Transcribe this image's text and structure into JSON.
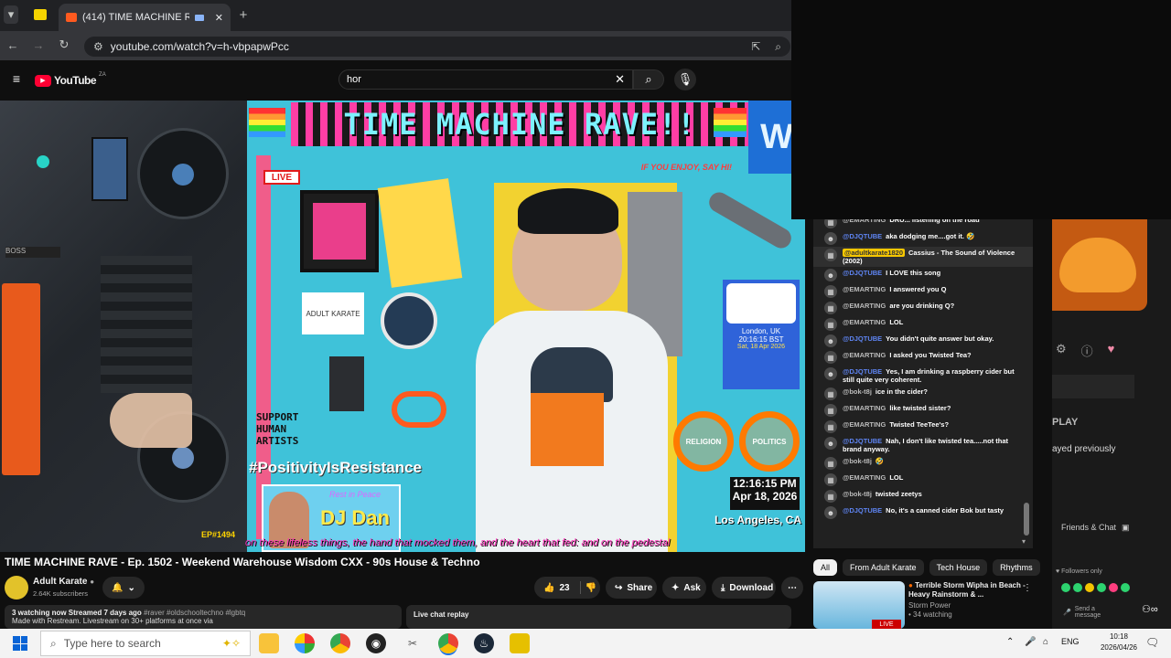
{
  "browser": {
    "tab_title": "(414) TIME MACHINE RAVE",
    "url": "youtube.com/watch?v=h-vbpapwPcc"
  },
  "youtube": {
    "logo": "YouTube",
    "logo_region": "ZA",
    "search_value": "hor"
  },
  "video": {
    "banner": "TIME MACHINE RAVE!!",
    "live_badge": "LIVE",
    "enjoy_text": "IF YOU ENJOY, SAY HI!",
    "karate_sign": "ADULT KARATE",
    "support_text": "SUPPORT HUMAN ARTISTS",
    "hashtag": "#PositivityIsResistance",
    "rip_text": "Rest in Peace",
    "rip_name": "DJ Dan",
    "london_city": "London, UK",
    "london_time": "20:16:15 BST",
    "london_date": "Sat, 18 Apr 2026",
    "religion_text": "RELIGION",
    "politics_text": "POLITICS",
    "la_time": "12:16:15 PM",
    "la_date": "Apr 18, 2026",
    "la_city": "Los Angeles, CA",
    "ticker": "on these lifeless things, the hand that mocked them, and the heart that fed: and on the pedestal",
    "flyer": "EP#1494"
  },
  "video_info": {
    "title": "TIME MACHINE RAVE - Ep. 1502 - Weekend Warehouse Wisdom CXX - 90s House & Techno",
    "channel": "Adult Karate",
    "subscribers": "2.64K subscribers",
    "likes": "23",
    "share": "Share",
    "ask": "Ask",
    "download": "Download",
    "stats": "3 watching now  Streamed 7 days ago",
    "tags": "#raver #oldschooltechno #lgbtq",
    "desc": "Made with Restream. Livestream on 30+ platforms at once via",
    "live_chat_replay": "Live chat replay"
  },
  "chat": {
    "messages": [
      {
        "author": "@EMARTING",
        "text": "DRU... listening on the road",
        "type": "gray"
      },
      {
        "author": "@DJQTUBE",
        "text": "aka dodging me....got it. 🤣",
        "type": "blue"
      },
      {
        "author": "@adultkarate1820",
        "text": "Cassius - The Sound of Violence (2002)",
        "type": "hl"
      },
      {
        "author": "@DJQTUBE",
        "text": "I LOVE this song",
        "type": "blue"
      },
      {
        "author": "@EMARTING",
        "text": "I answered you Q",
        "type": "gray"
      },
      {
        "author": "@EMARTING",
        "text": "are you drinking Q?",
        "type": "gray"
      },
      {
        "author": "@EMARTING",
        "text": "LOL",
        "type": "gray"
      },
      {
        "author": "@DJQTUBE",
        "text": "You didn't quite answer but okay.",
        "type": "blue"
      },
      {
        "author": "@EMARTING",
        "text": "I asked you Twisted Tea?",
        "type": "gray"
      },
      {
        "author": "@DJQTUBE",
        "text": "Yes, I am drinking a raspberry cider but still quite very coherent.",
        "type": "blue"
      },
      {
        "author": "@bok-t8j",
        "text": "ice in the cider?",
        "type": "gray"
      },
      {
        "author": "@EMARTING",
        "text": "like twisted sister?",
        "type": "gray"
      },
      {
        "author": "@EMARTING",
        "text": "Twisted TeeTee's?",
        "type": "gray"
      },
      {
        "author": "@DJQTUBE",
        "text": "Nah, I don't like twisted tea.....not that brand anyway.",
        "type": "blue"
      },
      {
        "author": "@bok-t8j",
        "text": "🤣",
        "type": "gray"
      },
      {
        "author": "@EMARTING",
        "text": "LOL",
        "type": "gray"
      },
      {
        "author": "@bok-t8j",
        "text": "twisted zeetys",
        "type": "gray"
      },
      {
        "author": "@DJQTUBE",
        "text": "No, it's a canned cider Bok but tasty",
        "type": "blue"
      }
    ]
  },
  "chips": [
    "All",
    "From Adult Karate",
    "Tech House",
    "Rhythms"
  ],
  "recommended": {
    "title": "Terrible Storm Wipha in Beach - Heavy Rainstorm & ...",
    "channel": "Storm Power",
    "watching": "34 watching",
    "badge": "LIVE"
  },
  "side": {
    "play": "PLAY",
    "played_previously": "ayed previously",
    "friends_chat": "Friends & Chat",
    "followers_only": "Followers only",
    "send_message": "Send a message"
  },
  "taskbar": {
    "search_placeholder": "Type here to search",
    "lang": "ENG",
    "time": "10:18",
    "date": "2026/04/26"
  }
}
